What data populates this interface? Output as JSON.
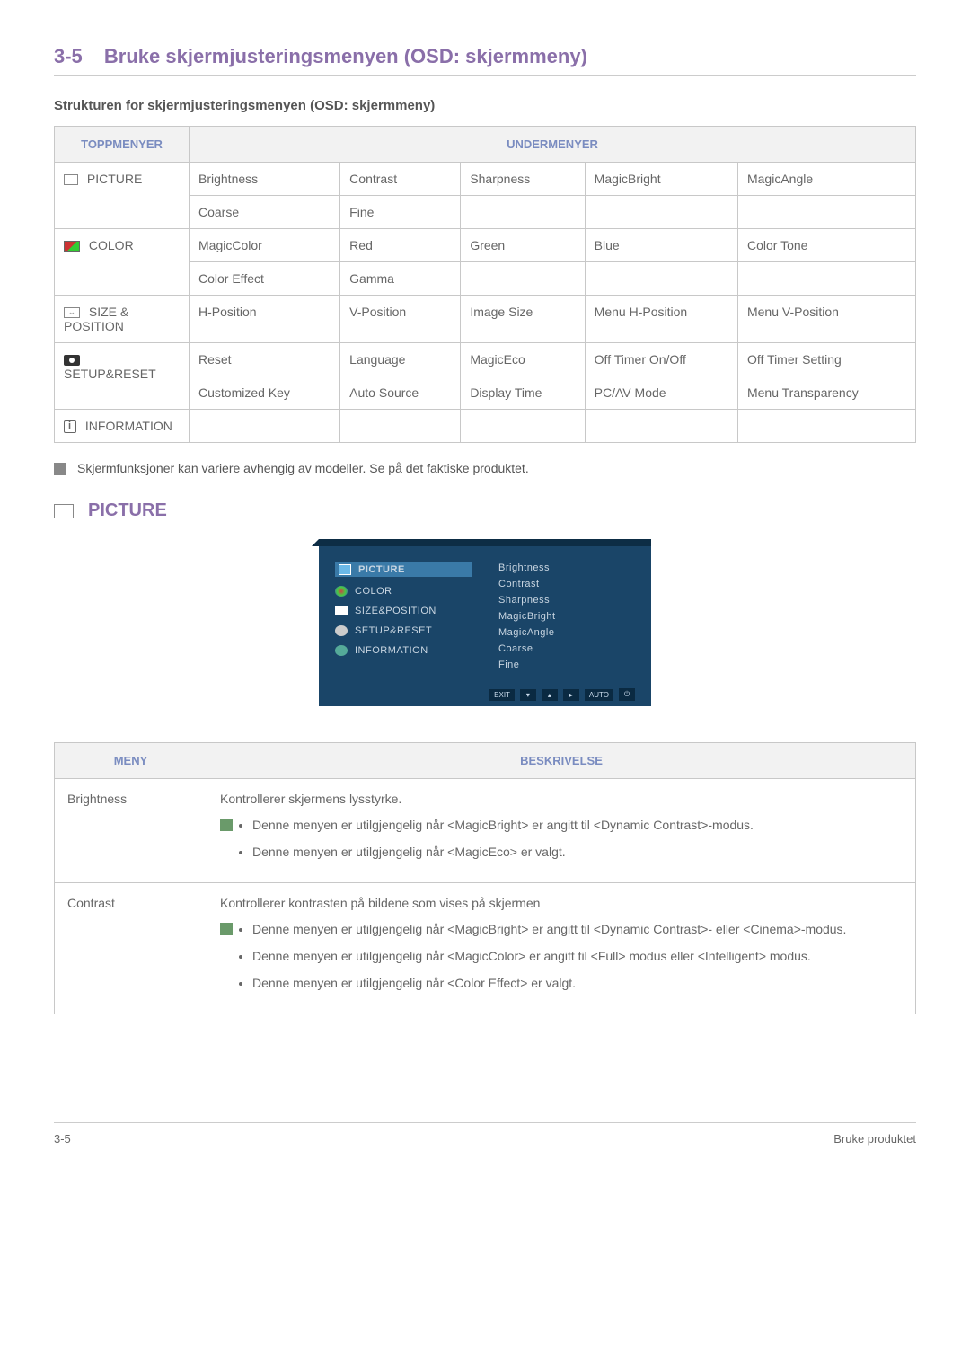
{
  "heading": {
    "num": "3-5",
    "title": "Bruke skjermjusteringsmenyen (OSD: skjermmeny)"
  },
  "sub_heading": "Strukturen for skjermjusteringsmenyen (OSD: skjermmeny)",
  "table_headers": {
    "top": "TOPPMENYER",
    "sub": "UNDERMENYER"
  },
  "top_menus": {
    "picture": "PICTURE",
    "color": "COLOR",
    "size": "SIZE & POSITION",
    "setup": "SETUP&RESET",
    "info": "INFORMATION"
  },
  "submenus": {
    "picture_r1": [
      "Brightness",
      "Contrast",
      "Sharpness",
      "MagicBright",
      "MagicAngle"
    ],
    "picture_r2": [
      "Coarse",
      "Fine",
      "",
      "",
      ""
    ],
    "color_r1": [
      "MagicColor",
      "Red",
      "Green",
      "Blue",
      "Color Tone"
    ],
    "color_r2": [
      "Color Effect",
      "Gamma",
      "",
      "",
      ""
    ],
    "size_r1": [
      "H-Position",
      "V-Position",
      "Image Size",
      "Menu H-Position",
      "Menu V-Position"
    ],
    "setup_r1": [
      "Reset",
      "Language",
      "MagicEco",
      "Off Timer On/Off",
      "Off Timer Setting"
    ],
    "setup_r2": [
      "Customized Key",
      "Auto Source",
      "Display Time",
      "PC/AV Mode",
      "Menu Transparency"
    ],
    "info_r1": [
      "",
      "",
      "",
      "",
      ""
    ]
  },
  "note1": "Skjermfunksjoner kan variere avhengig av modeller. Se på det faktiske produktet.",
  "picture_section_title": "PICTURE",
  "osd": {
    "left": [
      "PICTURE",
      "COLOR",
      "SIZE&POSITION",
      "SETUP&RESET",
      "INFORMATION"
    ],
    "right": [
      "Brightness",
      "Contrast",
      "Sharpness",
      "MagicBright",
      "MagicAngle",
      "Coarse",
      "Fine"
    ],
    "buttons": [
      "EXIT",
      "▾",
      "▴",
      "▸",
      "AUTO",
      "⏻"
    ]
  },
  "desc_headers": {
    "menu": "MENY",
    "desc": "BESKRIVELSE"
  },
  "desc": {
    "brightness": {
      "name": "Brightness",
      "intro": "Kontrollerer skjermens lysstyrke.",
      "bullets": [
        "Denne menyen er utilgjengelig når <MagicBright> er angitt til <Dynamic Contrast>-modus.",
        "Denne menyen er utilgjengelig når <MagicEco> er valgt."
      ]
    },
    "contrast": {
      "name": "Contrast",
      "intro": "Kontrollerer kontrasten på bildene som vises på skjermen",
      "bullets": [
        "Denne menyen er utilgjengelig når <MagicBright> er angitt til <Dynamic Contrast>- eller <Cinema>-modus.",
        "Denne menyen er utilgjengelig når <MagicColor> er angitt til <Full> modus eller <Intelligent> modus.",
        "Denne menyen er utilgjengelig når <Color Effect> er valgt."
      ]
    }
  },
  "footer": {
    "left": "3-5",
    "right": "Bruke produktet"
  }
}
